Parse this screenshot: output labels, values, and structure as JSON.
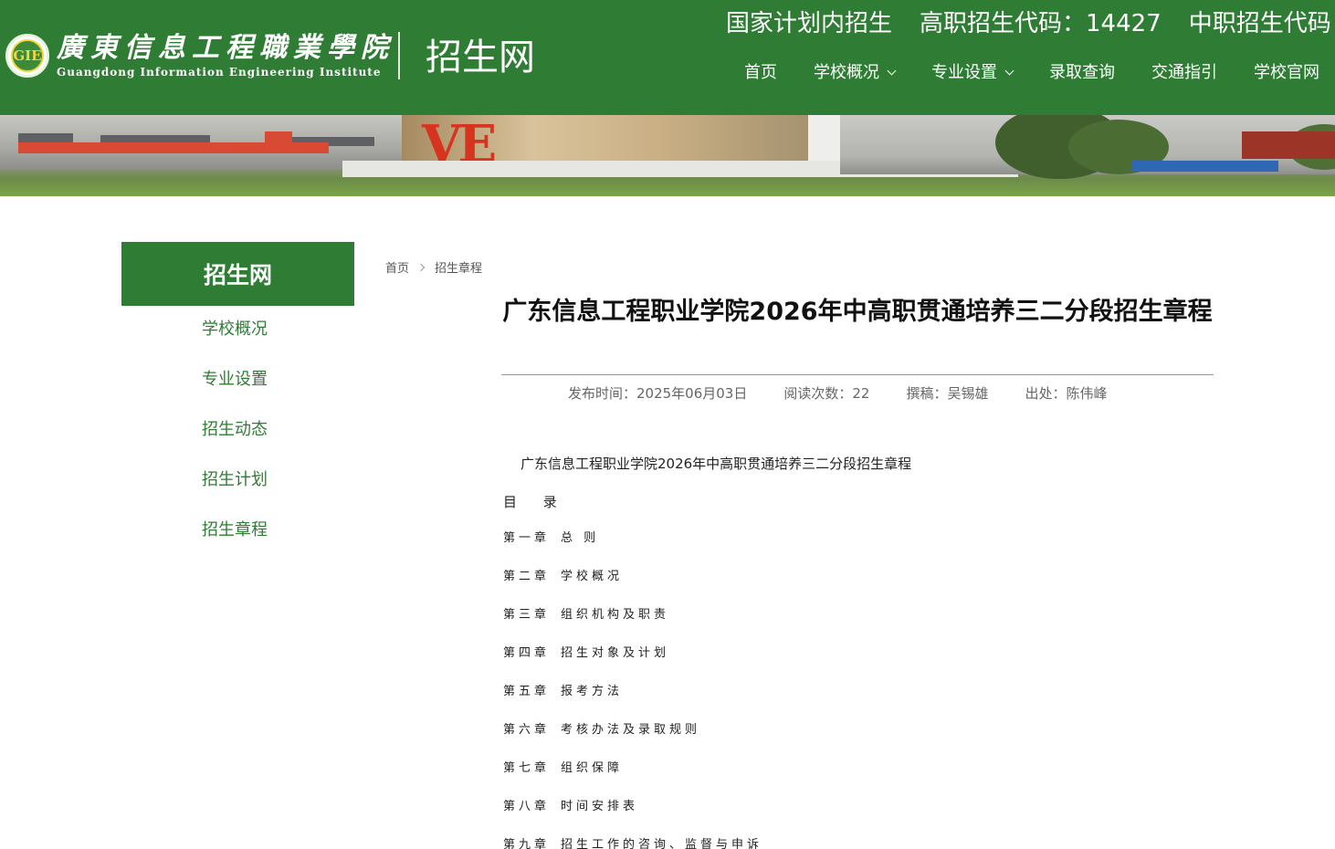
{
  "header": {
    "logo_cn": "廣東信息工程職業學院",
    "logo_en": "Guangdong Information Engineering Institute",
    "logo_emblem_text": "GIE",
    "site_name": "招生网",
    "codes": [
      "国家计划内招生",
      "高职招生代码：14427",
      "中职招生代码："
    ],
    "nav": [
      {
        "label": "首页",
        "has_dropdown": false
      },
      {
        "label": "学校概况",
        "has_dropdown": true
      },
      {
        "label": "专业设置",
        "has_dropdown": true
      },
      {
        "label": "录取查询",
        "has_dropdown": false
      },
      {
        "label": "交通指引",
        "has_dropdown": false
      },
      {
        "label": "学校官网",
        "has_dropdown": false
      }
    ]
  },
  "banner": {
    "sign_text": "VE"
  },
  "sidebar": {
    "title": "招生网",
    "items": [
      "学校概况",
      "专业设置",
      "招生动态",
      "招生计划",
      "招生章程"
    ]
  },
  "breadcrumb": {
    "home": "首页",
    "current": "招生章程"
  },
  "article": {
    "title": "广东信息工程职业学院2026年中高职贯通培养三二分段招生章程",
    "meta": {
      "publish": "发布时间：2025年06月03日",
      "reads": "阅读次数：22",
      "author": "撰稿：吴锡雄",
      "source": "出处：陈伟峰"
    },
    "body_title": "广东信息工程职业学院2026年中高职贯通培养三二分段招生章程",
    "toc_heading": "目 录",
    "toc": [
      {
        "chapter": "第一章",
        "name": "总  则"
      },
      {
        "chapter": "第二章",
        "name": "学校概况"
      },
      {
        "chapter": "第三章",
        "name": "组织机构及职责"
      },
      {
        "chapter": "第四章",
        "name": "招生对象及计划"
      },
      {
        "chapter": "第五章",
        "name": "报考方法"
      },
      {
        "chapter": "第六章",
        "name": "考核办法及录取规则"
      },
      {
        "chapter": "第七章",
        "name": "组织保障"
      },
      {
        "chapter": "第八章",
        "name": "时间安排表"
      },
      {
        "chapter": "第九章",
        "name": "招生工作的咨询、监督与申诉"
      }
    ]
  },
  "colors": {
    "brand_green": "#2f7d34",
    "text_dark": "#111111",
    "meta_gray": "#666666"
  }
}
